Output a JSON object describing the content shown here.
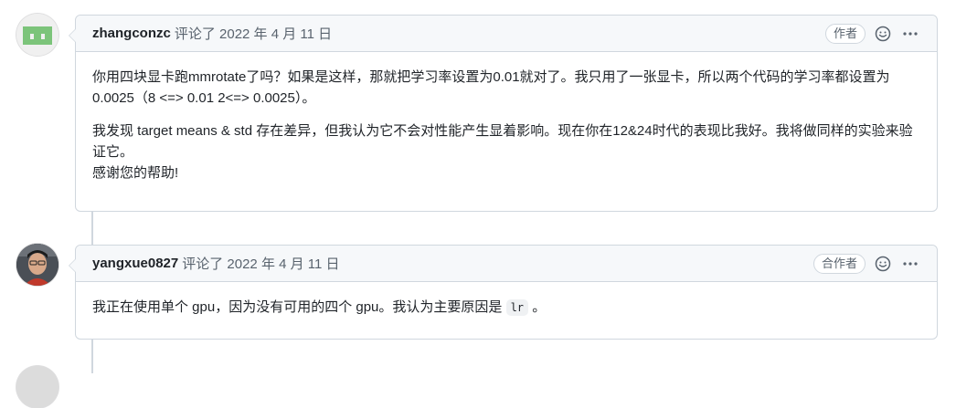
{
  "comments": [
    {
      "author": "zhangconzc",
      "meta": "评论了 2022 年 4 月 11 日",
      "badge": "作者",
      "paragraphs": [
        "你用四块显卡跑mmrotate了吗？如果是这样，那就把学习率设置为0.01就对了。我只用了一张显卡，所以两个代码的学习率都设置为0.0025（8 <=> 0.01 2<=> 0.0025）。",
        "我发现 target means & std 存在差异，但我认为它不会对性能产生显着影响。现在你在12&24时代的表现比我好。我将做同样的实验来验证它。",
        "感谢您的帮助!"
      ]
    },
    {
      "author": "yangxue0827",
      "meta": "评论了 2022 年 4 月 11 日",
      "badge": "合作者",
      "text_before": "我正在使用单个 gpu，因为没有可用的四个 gpu。我认为主要原因是",
      "code": "lr",
      "text_after": "。"
    }
  ],
  "colors": {
    "border": "#d0d7de",
    "header_bg": "#f6f8fa",
    "muted": "#59636e",
    "avatar_green": "#7cc47a"
  },
  "icons": [
    "smiley-icon",
    "kebab-menu-icon"
  ]
}
